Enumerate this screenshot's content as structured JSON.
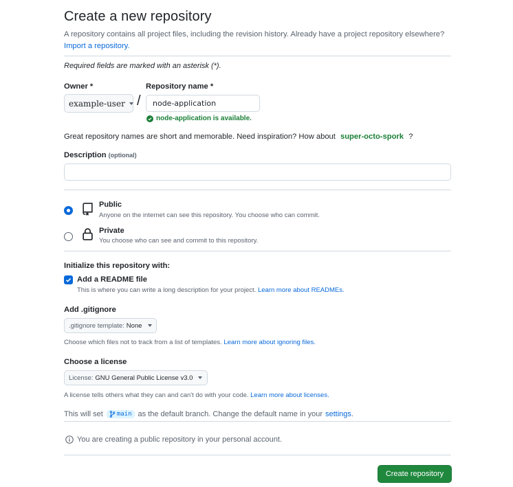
{
  "page": {
    "title": "Create a new repository",
    "subtitle": "A repository contains all project files, including the revision history. Already have a project repository elsewhere?",
    "import_link": "Import a repository.",
    "required_note": "Required fields are marked with an asterisk (*)."
  },
  "owner": {
    "label": "Owner *",
    "value": "example-user"
  },
  "repo_name": {
    "label": "Repository name *",
    "value": "node-application",
    "availability": "node-application is available."
  },
  "inspiration": {
    "text": "Great repository names are short and memorable. Need inspiration? How about",
    "suggestion": "super-octo-spork",
    "end": "?"
  },
  "description": {
    "label": "Description",
    "optional": "(optional)",
    "value": ""
  },
  "visibility": {
    "public": {
      "title": "Public",
      "desc": "Anyone on the internet can see this repository. You choose who can commit.",
      "selected": true
    },
    "private": {
      "title": "Private",
      "desc": "You choose who can see and commit to this repository.",
      "selected": false
    }
  },
  "init": {
    "heading": "Initialize this repository with:",
    "readme": {
      "label": "Add a README file",
      "checked": true,
      "desc": "This is where you can write a long description for your project.",
      "link": "Learn more about READMEs."
    }
  },
  "gitignore": {
    "heading": "Add .gitignore",
    "select_key": ".gitignore template:",
    "select_value": "None",
    "desc": "Choose which files not to track from a list of templates.",
    "link": "Learn more about ignoring files."
  },
  "license": {
    "heading": "Choose a license",
    "select_key": "License:",
    "select_value": "GNU General Public License v3.0",
    "desc": "A license tells others what they can and can't do with your code.",
    "link": "Learn more about licenses."
  },
  "branch": {
    "prefix": "This will set",
    "name": "main",
    "middle": "as the default branch. Change the default name in your",
    "link": "settings",
    "end": "."
  },
  "info": {
    "text": "You are creating a public repository in your personal account."
  },
  "submit": {
    "label": "Create repository"
  },
  "colors": {
    "primary_green": "#1f883d",
    "link_blue": "#0969da",
    "success_green": "#1a7f37"
  }
}
